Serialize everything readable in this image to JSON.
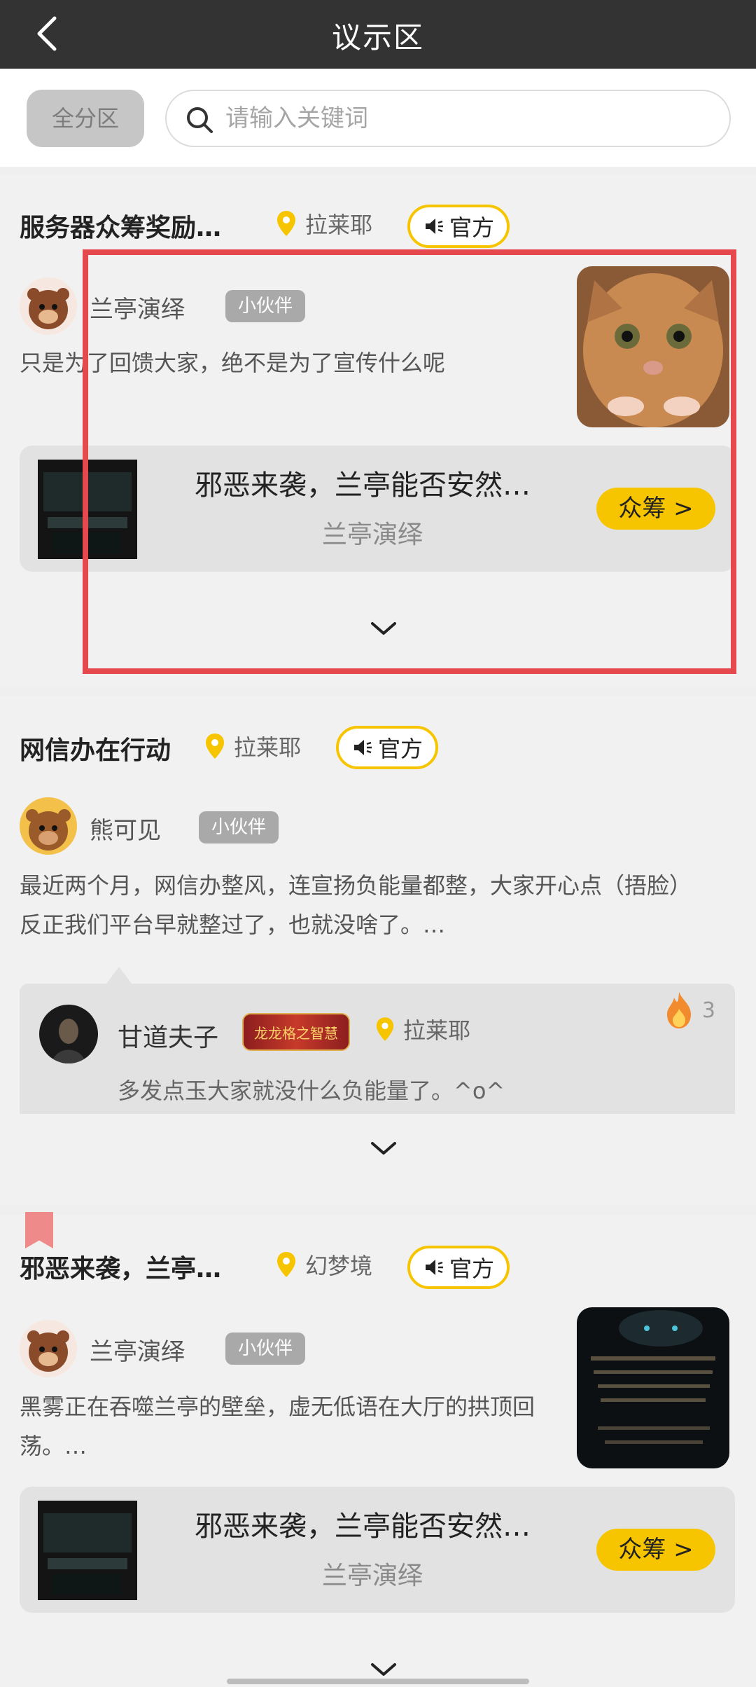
{
  "header": {
    "title": "议示区"
  },
  "search": {
    "zone_label": "全分区",
    "placeholder": "请输入关键词"
  },
  "posts": [
    {
      "title": "服务器众筹奖励…",
      "location": "拉莱耶",
      "tag": "官方",
      "author": "兰亭演绎",
      "badge": "小伙伴",
      "excerpt": "只是为了回馈大家，绝不是为了宣传什么呢",
      "crowdfund": {
        "title": "邪恶来袭，兰亭能否安然…",
        "author": "兰亭演绎",
        "button": "众筹 >"
      }
    },
    {
      "title": "网信办在行动",
      "location": "拉莱耶",
      "tag": "官方",
      "author": "熊可见",
      "badge": "小伙伴",
      "excerpt_lines": [
        "最近两个月，网信办整风，连宣扬负能量都整，大家开心点（捂脸）",
        "反正我们平台早就整过了，也就没啥了。…"
      ],
      "reply": {
        "author": "甘道夫子",
        "title_badge": "龙龙格之智慧",
        "location": "拉莱耶",
        "heat": "3",
        "text": "多发点玉大家就没什么负能量了。^o^"
      }
    },
    {
      "title": "邪恶来袭，兰亭…",
      "location": "幻梦境",
      "tag": "官方",
      "author": "兰亭演绎",
      "badge": "小伙伴",
      "excerpt_lines": [
        "黑雾正在吞噬兰亭的壁垒，虚无低语在大厅的拱顶回",
        "荡。…"
      ],
      "crowdfund": {
        "title": "邪恶来袭，兰亭能否安然…",
        "author": "兰亭演绎",
        "button": "众筹 >"
      }
    }
  ],
  "colors": {
    "accent": "#f7c500",
    "highlight": "#e5484d",
    "topbar": "#333333"
  }
}
